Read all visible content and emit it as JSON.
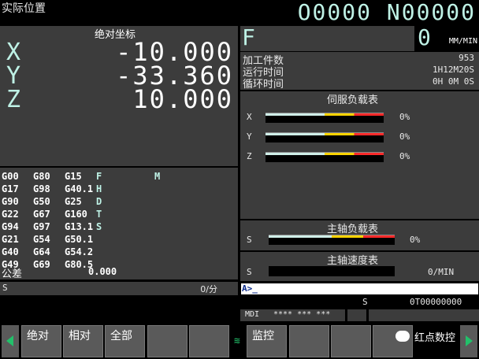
{
  "header": {
    "title": "实际位置",
    "program": "O0000 N00000"
  },
  "position": {
    "title": "绝对坐标",
    "axes": [
      {
        "label": "X",
        "value": "-10.000"
      },
      {
        "label": "Y",
        "value": "-33.360"
      },
      {
        "label": "Z",
        "value": "10.000"
      }
    ]
  },
  "feed": {
    "label": "F",
    "value": "0",
    "unit": "MM/MIN"
  },
  "counters": {
    "parts_label": "加工件数",
    "parts_value": "953",
    "run_label": "运行时间",
    "run_value": "1H12M20S",
    "cycle_label": "循环时间",
    "cycle_value": "0H 0M 0S"
  },
  "servo_load": {
    "title": "伺服负载表",
    "axes": [
      {
        "label": "X",
        "percent": "0%",
        "level": 0
      },
      {
        "label": "Y",
        "percent": "0%",
        "level": 0
      },
      {
        "label": "Z",
        "percent": "0%",
        "level": 0
      }
    ]
  },
  "gcodes": {
    "rows": [
      [
        "G00",
        "G80",
        "G15",
        "F",
        ""
      ],
      [
        "G17",
        "G98",
        "G40.1",
        "H",
        ""
      ],
      [
        "G90",
        "G50",
        "G25",
        "D",
        ""
      ],
      [
        "G22",
        "G67",
        "G160",
        "T",
        ""
      ],
      [
        "G94",
        "G97",
        "G13.1",
        "S",
        ""
      ],
      [
        "G21",
        "G54",
        "G50.1",
        "",
        ""
      ],
      [
        "G40",
        "G64",
        "G54.2",
        "",
        ""
      ],
      [
        "G49",
        "G69",
        "G80.5",
        "",
        ""
      ]
    ],
    "extra": "M",
    "tolerance_label": "公差",
    "tolerance_value": "0.000"
  },
  "spindle_status": {
    "label": "S",
    "value": "0/分"
  },
  "spindle_load": {
    "title": "主轴负载表",
    "label": "S",
    "percent": "0%",
    "level": 0
  },
  "spindle_speed": {
    "title": "主轴速度表",
    "label": "S",
    "value": "0/MIN"
  },
  "command_line": {
    "prompt": "A>_"
  },
  "status_line": {
    "s_label": "S",
    "tool": "0T00000000"
  },
  "mode_bar": {
    "mode": "MDI",
    "stars": "**** *** ***"
  },
  "softkeys": [
    {
      "label": "绝对"
    },
    {
      "label": "相对"
    },
    {
      "label": "全部"
    },
    {
      "label": ""
    },
    {
      "label": ""
    },
    {
      "label": "监控"
    },
    {
      "label": ""
    },
    {
      "label": ""
    },
    {
      "label": ""
    }
  ],
  "watermark": "红点数控",
  "colors": {
    "panel": "#3c3c3c",
    "accent": "#bff2e6",
    "softkey": "#5a5a5a",
    "arrow": "#22c06a"
  }
}
